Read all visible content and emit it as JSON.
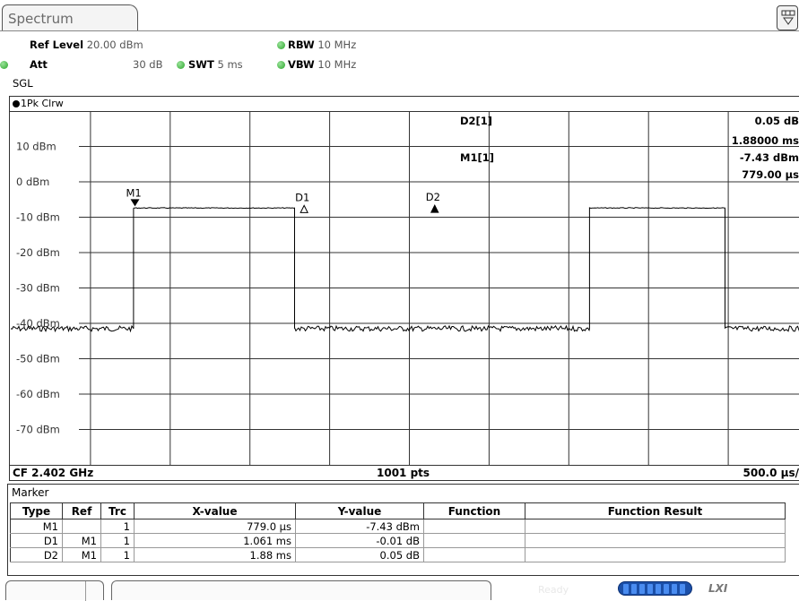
{
  "tab": {
    "label": "Spectrum"
  },
  "settings": {
    "ref_level_label": "Ref Level",
    "ref_level_value": "20.00 dBm",
    "att_label": "Att",
    "att_value": "30 dB",
    "swt_label": "SWT",
    "swt_value": "5 ms",
    "rbw_label": "RBW",
    "rbw_value": "10 MHz",
    "vbw_label": "VBW",
    "vbw_value": "10 MHz",
    "mode": "SGL"
  },
  "trace": {
    "label": "1Pk Clrw"
  },
  "readout": {
    "d2_label": "D2[1]",
    "d2_y": "0.05 dB",
    "d2_x": "1.88000 ms",
    "m1_label": "M1[1]",
    "m1_y": "-7.43 dBm",
    "m1_x": "779.00 µs"
  },
  "chart_data": {
    "type": "line",
    "y_ticks": [
      "10 dBm",
      "0 dBm",
      "-10 dBm",
      "-20 dBm",
      "-30 dBm",
      "-40 dBm",
      "-50 dBm",
      "-60 dBm",
      "-70 dBm"
    ],
    "ylim": [
      -80,
      20
    ],
    "xlim_ms": [
      0,
      5
    ],
    "x_divisions": 10,
    "y_unit": "dBm",
    "x_unit": "ms",
    "series": [
      {
        "x": [
          0,
          0.77,
          0.77,
          1.78,
          1.78,
          3.63,
          3.63,
          4.48,
          4.48,
          5.0
        ],
        "y": [
          -41.5,
          -41.5,
          -7.4,
          -7.4,
          -41.5,
          -41.5,
          -7.4,
          -7.4,
          -41.5,
          -41.5
        ]
      }
    ],
    "markers": [
      {
        "name": "M1",
        "x": 0.779,
        "y": -7.43,
        "style": "filled-down"
      },
      {
        "name": "D1",
        "x": 1.84,
        "y": -7.44,
        "style": "hollow-up"
      },
      {
        "name": "D2",
        "x": 2.659,
        "y": -7.38,
        "style": "filled-up"
      }
    ],
    "footer": {
      "cf": "CF 2.402 GHz",
      "pts": "1001 pts",
      "span": "500.0 µs/"
    }
  },
  "marker_table": {
    "title": "Marker",
    "columns": [
      "Type",
      "Ref",
      "Trc",
      "X-value",
      "Y-value",
      "Function",
      "Function Result"
    ],
    "rows": [
      [
        "M1",
        "",
        "1",
        "779.0 µs",
        "-7.43 dBm",
        "",
        ""
      ],
      [
        "D1",
        "M1",
        "1",
        "1.061 ms",
        "-0.01 dB",
        "",
        ""
      ],
      [
        "D2",
        "M1",
        "1",
        "1.88 ms",
        "0.05 dB",
        "",
        ""
      ]
    ]
  },
  "status": {
    "text": "Ready"
  },
  "colors": {
    "grid": "#333333",
    "trace": "#000000",
    "progress": "#1b4fa8"
  }
}
